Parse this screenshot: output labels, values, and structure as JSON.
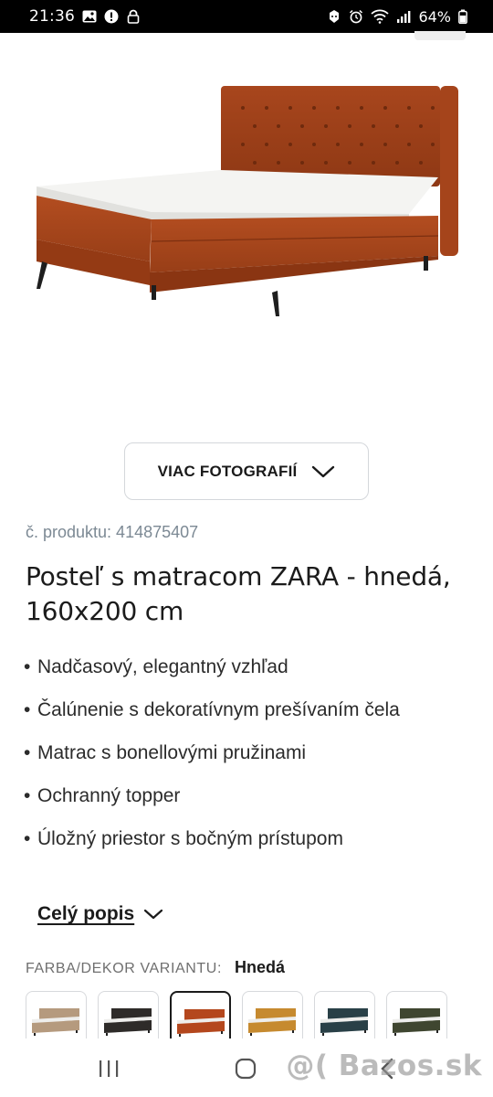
{
  "status_bar": {
    "time": "21:36",
    "battery": "64%"
  },
  "gallery": {
    "more_photos_label": "VIAC FOTOGRAFIÍ"
  },
  "product": {
    "code": "č. produktu: 414875407",
    "title": "Posteľ s matracom ZARA - hnedá, 160x200 cm",
    "features": [
      "Nadčasový, elegantný vzhľad",
      "Čalúnenie s dekoratívnym prešívaním čela",
      "Matrac s bonellovými pružinami",
      "Ochranný topper",
      "Úložný priestor s bočným prístupom"
    ],
    "full_description_label": "Celý popis"
  },
  "variants": {
    "label": "FARBA/DEKOR VARIANTU:",
    "selected": "Hnedá",
    "swatch_colors": [
      "#b59a7e",
      "#2e2b29",
      "#b4471d",
      "#c68a2f",
      "#294047",
      "#3f4630"
    ],
    "selected_index": 2
  },
  "watermark": "@( Bazos.sk"
}
